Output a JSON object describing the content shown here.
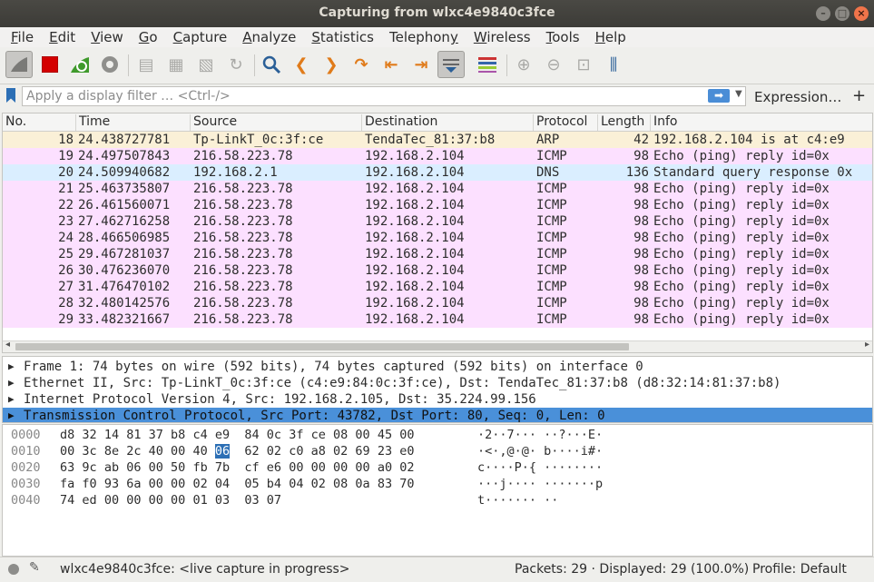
{
  "window": {
    "title": "Capturing from wlxc4e9840c3fce"
  },
  "menu": [
    {
      "u": "F",
      "rest": "ile"
    },
    {
      "u": "E",
      "rest": "dit"
    },
    {
      "u": "V",
      "rest": "iew"
    },
    {
      "u": "G",
      "rest": "o"
    },
    {
      "u": "C",
      "rest": "apture"
    },
    {
      "u": "A",
      "rest": "nalyze"
    },
    {
      "u": "S",
      "rest": "tatistics"
    },
    {
      "u": "",
      "rest": "Telephon",
      "u2": "y"
    },
    {
      "u": "W",
      "rest": "ireless"
    },
    {
      "u": "T",
      "rest": "ools"
    },
    {
      "u": "H",
      "rest": "elp"
    }
  ],
  "filter": {
    "placeholder": "Apply a display filter … <Ctrl-/>",
    "expression_label": "Expression…",
    "add_label": "+"
  },
  "packet_list": {
    "columns": [
      "No.",
      "Time",
      "Source",
      "Destination",
      "Protocol",
      "Length",
      "Info"
    ],
    "rows": [
      {
        "no": "18",
        "time": "24.438727781",
        "src": "Tp-LinkT_0c:3f:ce",
        "dst": "TendaTec_81:37:b8",
        "proto": "ARP",
        "len": "42",
        "info": "192.168.2.104 is at c4:e9",
        "color": "#faf0d7"
      },
      {
        "no": "19",
        "time": "24.497507843",
        "src": "216.58.223.78",
        "dst": "192.168.2.104",
        "proto": "ICMP",
        "len": "98",
        "info": "Echo (ping) reply    id=0x",
        "color": "#fce0ff"
      },
      {
        "no": "20",
        "time": "24.509940682",
        "src": "192.168.2.1",
        "dst": "192.168.2.104",
        "proto": "DNS",
        "len": "136",
        "info": "Standard query response 0x",
        "color": "#daeeff"
      },
      {
        "no": "21",
        "time": "25.463735807",
        "src": "216.58.223.78",
        "dst": "192.168.2.104",
        "proto": "ICMP",
        "len": "98",
        "info": "Echo (ping) reply    id=0x",
        "color": "#fce0ff"
      },
      {
        "no": "22",
        "time": "26.461560071",
        "src": "216.58.223.78",
        "dst": "192.168.2.104",
        "proto": "ICMP",
        "len": "98",
        "info": "Echo (ping) reply    id=0x",
        "color": "#fce0ff"
      },
      {
        "no": "23",
        "time": "27.462716258",
        "src": "216.58.223.78",
        "dst": "192.168.2.104",
        "proto": "ICMP",
        "len": "98",
        "info": "Echo (ping) reply    id=0x",
        "color": "#fce0ff"
      },
      {
        "no": "24",
        "time": "28.466506985",
        "src": "216.58.223.78",
        "dst": "192.168.2.104",
        "proto": "ICMP",
        "len": "98",
        "info": "Echo (ping) reply    id=0x",
        "color": "#fce0ff"
      },
      {
        "no": "25",
        "time": "29.467281037",
        "src": "216.58.223.78",
        "dst": "192.168.2.104",
        "proto": "ICMP",
        "len": "98",
        "info": "Echo (ping) reply    id=0x",
        "color": "#fce0ff"
      },
      {
        "no": "26",
        "time": "30.476236070",
        "src": "216.58.223.78",
        "dst": "192.168.2.104",
        "proto": "ICMP",
        "len": "98",
        "info": "Echo (ping) reply    id=0x",
        "color": "#fce0ff"
      },
      {
        "no": "27",
        "time": "31.476470102",
        "src": "216.58.223.78",
        "dst": "192.168.2.104",
        "proto": "ICMP",
        "len": "98",
        "info": "Echo (ping) reply    id=0x",
        "color": "#fce0ff"
      },
      {
        "no": "28",
        "time": "32.480142576",
        "src": "216.58.223.78",
        "dst": "192.168.2.104",
        "proto": "ICMP",
        "len": "98",
        "info": "Echo (ping) reply    id=0x",
        "color": "#fce0ff"
      },
      {
        "no": "29",
        "time": "33.482321667",
        "src": "216.58.223.78",
        "dst": "192.168.2.104",
        "proto": "ICMP",
        "len": "98",
        "info": "Echo (ping) reply    id=0x",
        "color": "#fce0ff"
      }
    ]
  },
  "details": [
    {
      "text": "Frame 1: 74 bytes on wire (592 bits), 74 bytes captured (592 bits) on interface 0",
      "selected": false
    },
    {
      "text": "Ethernet II, Src: Tp-LinkT_0c:3f:ce (c4:e9:84:0c:3f:ce), Dst: TendaTec_81:37:b8 (d8:32:14:81:37:b8)",
      "selected": false
    },
    {
      "text": "Internet Protocol Version 4, Src: 192.168.2.105, Dst: 35.224.99.156",
      "selected": false
    },
    {
      "text": "Transmission Control Protocol, Src Port: 43782, Dst Port: 80, Seq: 0, Len: 0",
      "selected": true
    }
  ],
  "hex": [
    {
      "off": "0000",
      "bytes": [
        "d8",
        "32",
        "14",
        "81",
        "37",
        "b8",
        "c4",
        "e9",
        "84",
        "0c",
        "3f",
        "ce",
        "08",
        "00",
        "45",
        "00"
      ],
      "ascii": "·2··7··· ··?···E·"
    },
    {
      "off": "0010",
      "bytes": [
        "00",
        "3c",
        "8e",
        "2c",
        "40",
        "00",
        "40",
        "06",
        "62",
        "02",
        "c0",
        "a8",
        "02",
        "69",
        "23",
        "e0"
      ],
      "ascii": "·<·,@·@· b····i#·",
      "hl": 7
    },
    {
      "off": "0020",
      "bytes": [
        "63",
        "9c",
        "ab",
        "06",
        "00",
        "50",
        "fb",
        "7b",
        "cf",
        "e6",
        "00",
        "00",
        "00",
        "00",
        "a0",
        "02"
      ],
      "ascii": "c····P·{ ········"
    },
    {
      "off": "0030",
      "bytes": [
        "fa",
        "f0",
        "93",
        "6a",
        "00",
        "00",
        "02",
        "04",
        "05",
        "b4",
        "04",
        "02",
        "08",
        "0a",
        "83",
        "70"
      ],
      "ascii": "···j···· ·······p"
    },
    {
      "off": "0040",
      "bytes": [
        "74",
        "ed",
        "00",
        "00",
        "00",
        "00",
        "01",
        "03",
        "03",
        "07"
      ],
      "ascii": "t······· ··"
    }
  ],
  "status": {
    "capture_text": "wlxc4e9840c3fce: <live capture in progress>",
    "packets_text": "Packets: 29 · Displayed: 29 (100.0%)",
    "profile_text": "Profile: Default"
  }
}
